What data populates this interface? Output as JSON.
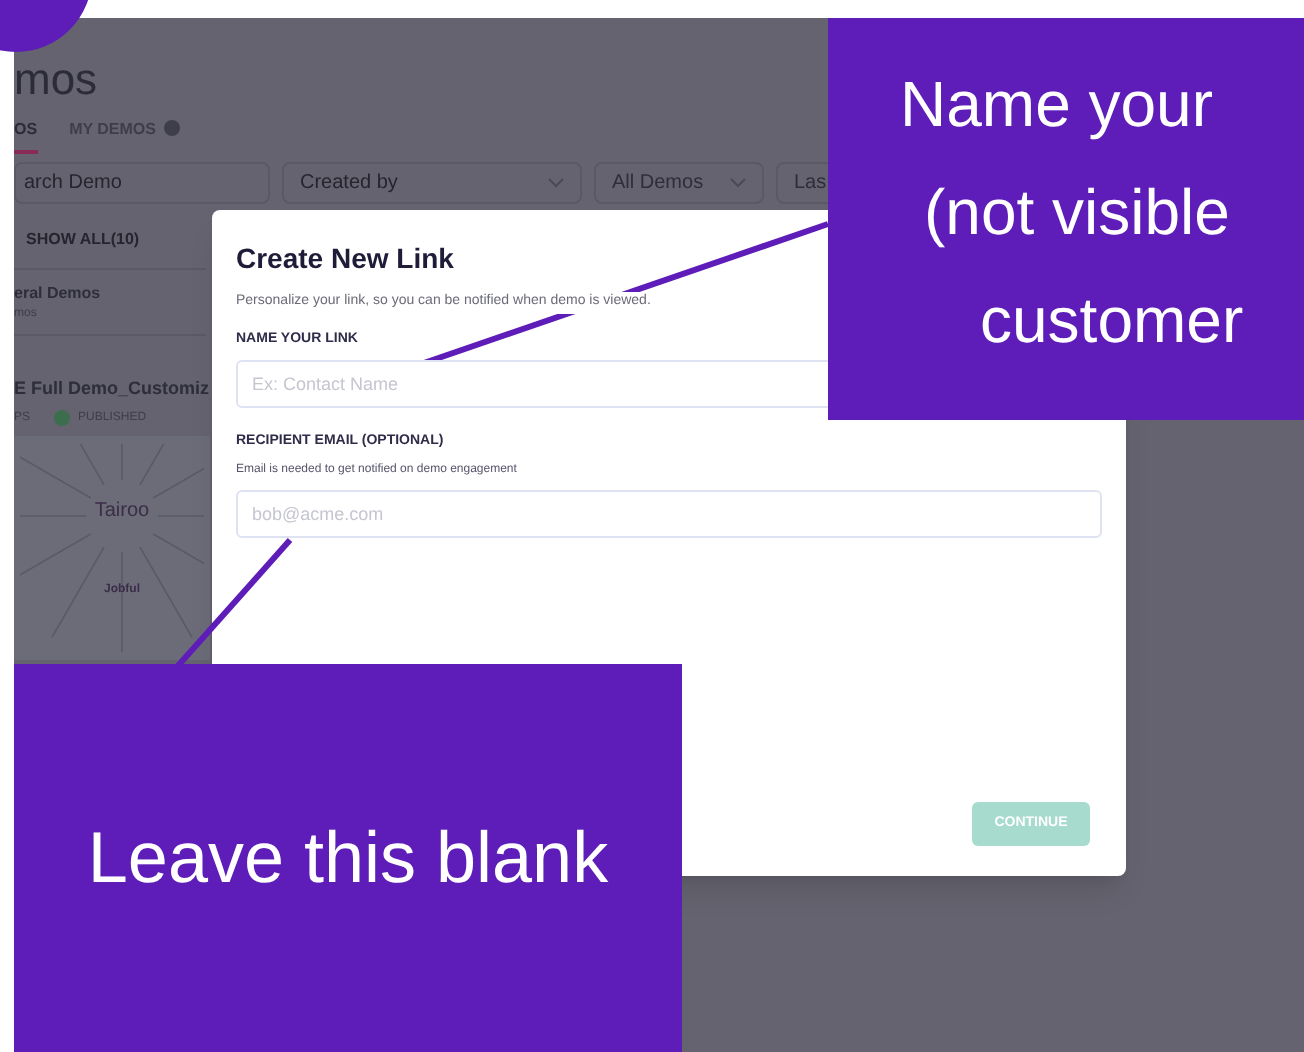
{
  "app": {
    "title": "mos",
    "tabs": [
      {
        "label": "OS",
        "selected": true
      },
      {
        "label": "MY DEMOS",
        "selected": false
      }
    ],
    "filters": {
      "search_placeholder": "arch Demo",
      "created_by": "Created by",
      "type": "All Demos",
      "date": "Las"
    },
    "show_all": "SHOW ALL(10)",
    "folder": {
      "name": "eral Demos",
      "count": "mos"
    },
    "demo": {
      "title": "E Full Demo_Customiz",
      "meta": "PS",
      "status": "PUBLISHED",
      "logo": "Tairoo",
      "label": "Jobful"
    }
  },
  "modal": {
    "title": "Create New Link",
    "subtitle": "Personalize your link, so you can be notified when demo is viewed.",
    "fields": [
      {
        "label": "NAME YOUR LINK",
        "placeholder": "Ex: Contact Name"
      },
      {
        "label": "RECIPIENT EMAIL (OPTIONAL)",
        "hint": "Email is needed to get notified on demo engagement",
        "placeholder": "bob@acme.com"
      }
    ],
    "continue_button": {
      "label": "CONTINUE",
      "disabled": true
    }
  },
  "callouts": [
    {
      "lines": [
        "Name your",
        "(not visible",
        "customer"
      ]
    },
    {
      "lines": [
        "Leave this blank"
      ]
    }
  ]
}
